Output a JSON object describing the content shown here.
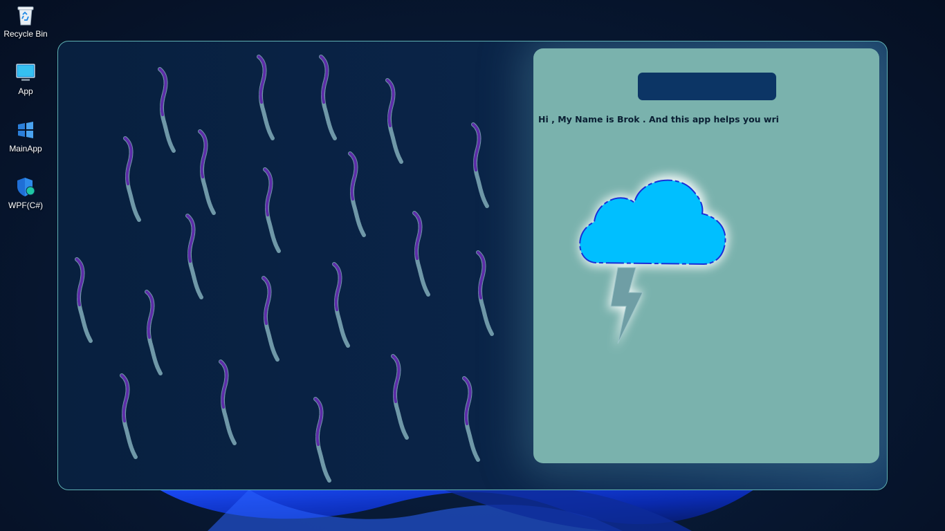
{
  "desktop": {
    "icons": [
      {
        "label": "Recycle Bin",
        "icon": "recycle-bin-icon"
      },
      {
        "label": "App",
        "icon": "monitor-icon"
      },
      {
        "label": "MainApp",
        "icon": "windows-logo-icon"
      },
      {
        "label": "WPF(C#)",
        "icon": "shield-icon"
      }
    ]
  },
  "app": {
    "intro_text": "Hi , My Name is Brok . And this app helps you wri",
    "name_bar_text": "",
    "colors": {
      "window_bg": "#08203f",
      "panel_bg": "#7ab2ad",
      "name_bar": "#0c3565",
      "cloud": "#00bfff",
      "cloud_outline": "#1a2fd6",
      "bolt": "#6f9ea5",
      "worm_head": "#5a1aa8",
      "worm_body": "#6f98a8"
    },
    "art": {
      "cloud": "cloud-icon",
      "bolt": "lightning-bolt-icon",
      "worms": "worm-icon"
    }
  }
}
